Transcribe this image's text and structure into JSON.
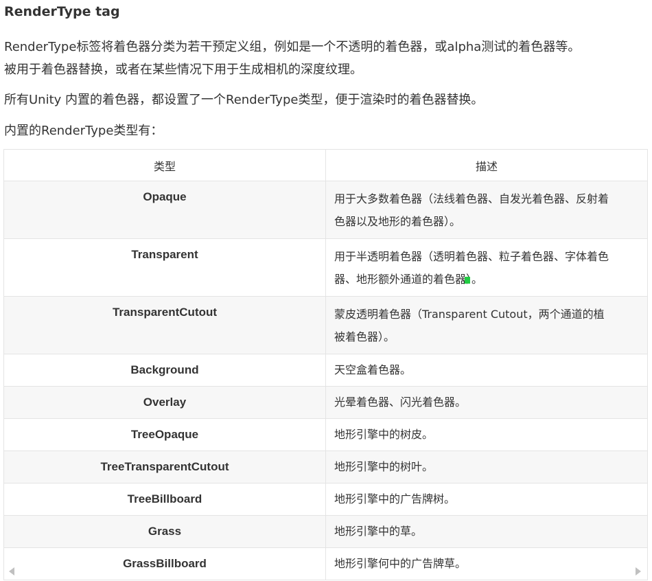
{
  "heading": "RenderType tag",
  "paragraphs": [
    "RenderType标签将着色器分类为若干预定义组，例如是一个不透明的着色器，或alpha测试的着色器等。被用于着色器替换，或者在某些情况下用于生成相机的深度纹理。",
    "所有Unity 内置的着色器，都设置了一个RenderType类型，便于渲染时的着色器替换。",
    "内置的RenderType类型有："
  ],
  "paragraph1_lines": [
    "RenderType标签将着色器分类为若干预定义组，例如是一个不透明的着色器，或alpha测试的着色器等。",
    "被用于着色器替换，或者在某些情况下用于生成相机的深度纹理。"
  ],
  "table": {
    "headers": [
      "类型",
      "描述"
    ],
    "rows": [
      {
        "type": "Opaque",
        "desc_lines": [
          "用于大多数着色器（法线着色器、自发光着色器、反射着",
          "色器以及地形的着色器）。"
        ]
      },
      {
        "type": "Transparent",
        "desc_lines": [
          "用于半透明着色器（透明着色器、粒子着色器、字体着色",
          "器、地形额外通道的着色器）。"
        ]
      },
      {
        "type": "TransparentCutout",
        "desc_lines": [
          " 蒙皮透明着色器（Transparent Cutout，两个通道的植",
          "被着色器）。"
        ]
      },
      {
        "type": "Background",
        "desc_lines": [
          "天空盒着色器。"
        ]
      },
      {
        "type": "Overlay",
        "desc_lines": [
          "光晕着色器、闪光着色器。"
        ]
      },
      {
        "type": "TreeOpaque",
        "desc_lines": [
          " 地形引擎中的树皮。"
        ]
      },
      {
        "type": "TreeTransparentCutout",
        "desc_lines": [
          "地形引擎中的树叶。"
        ]
      },
      {
        "type": "TreeBillboard",
        "desc_lines": [
          "地形引擎中的广告牌树。"
        ]
      },
      {
        "type": "Grass",
        "desc_lines": [
          "地形引擎中的草。"
        ]
      },
      {
        "type": "GrassBillboard",
        "desc_lines": [
          "地形引擎何中的广告牌草。"
        ]
      }
    ]
  },
  "icons": {
    "scroll_left": "triangle-left-icon",
    "scroll_right": "triangle-right-icon"
  },
  "colors": {
    "text": "#333333",
    "stripe": "#f7f7f7",
    "border": "#e4e4e4",
    "cursor_marker": "#22cc44"
  }
}
